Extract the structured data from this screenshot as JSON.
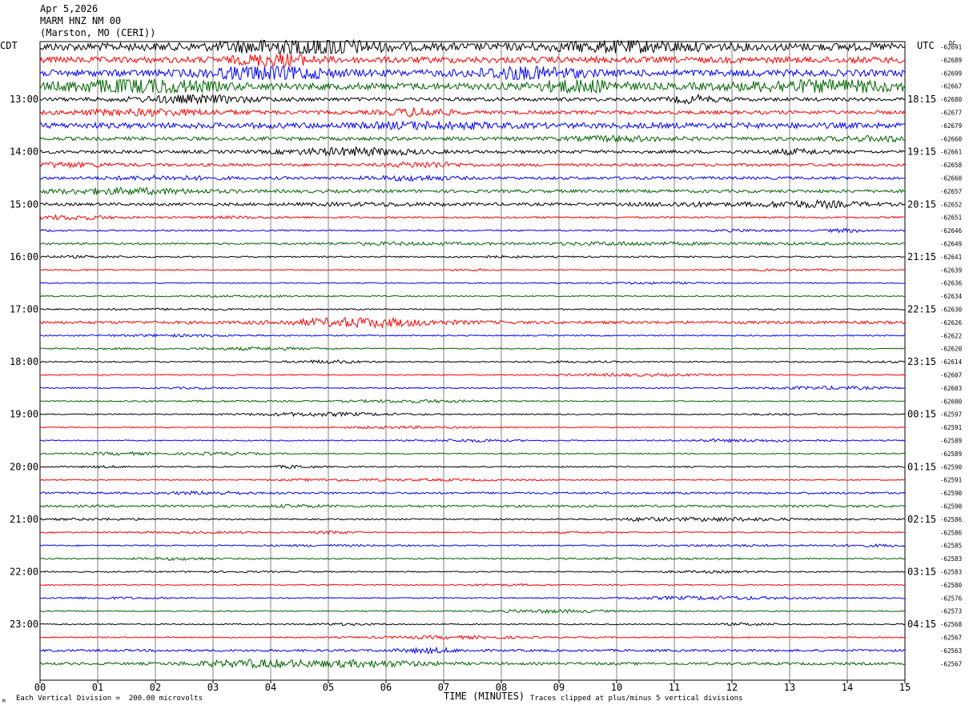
{
  "header": {
    "date": "Apr 5,2026",
    "station": "MARM HNZ NM 00",
    "location": "(Marston, MO (CERI))"
  },
  "chart_data": {
    "type": "line",
    "title": "MARM HNZ NM 00",
    "xlabel": "TIME (MINUTES)",
    "x_ticks": [
      "00",
      "01",
      "02",
      "03",
      "04",
      "05",
      "06",
      "07",
      "08",
      "09",
      "10",
      "11",
      "12",
      "13",
      "14",
      "15"
    ],
    "xlim": [
      0,
      15
    ],
    "left_axis_label": "CDT",
    "right_axis_label": "UTC",
    "dc_label": "DC",
    "left_hour_labels": [
      "13:00",
      "14:00",
      "15:00",
      "16:00",
      "17:00",
      "18:00",
      "19:00",
      "20:00",
      "21:00",
      "22:00",
      "23:00"
    ],
    "right_hour_labels": [
      "18:15",
      "19:15",
      "20:15",
      "21:15",
      "22:15",
      "23:15",
      "00:15",
      "01:15",
      "02:15",
      "03:15",
      "04:15"
    ],
    "trace_colors": [
      "#000000",
      "#ff0000",
      "#0000ff",
      "#006400"
    ],
    "dc_offsets": [
      -62691,
      -62689,
      -62699,
      -62667,
      -62680,
      -62677,
      -62679,
      -62660,
      -62661,
      -62658,
      -62660,
      -62657,
      -62652,
      -62651,
      -62646,
      -62649,
      -62641,
      -62639,
      -62636,
      -62634,
      -62630,
      -62626,
      -62622,
      -62620,
      -62614,
      -62607,
      -62603,
      -62600,
      -62597,
      -62591,
      -62589,
      -62589,
      -62590,
      -62591,
      -62590,
      -62590,
      -62586,
      -62586,
      -62585,
      -62583,
      -62583,
      -62580,
      -62576,
      -62573,
      -62568,
      -62567,
      -62563,
      -62567
    ],
    "trace_activity": [
      3.0,
      2.4,
      2.6,
      2.6,
      1.4,
      1.4,
      2.2,
      1.4,
      1.2,
      1.1,
      1.1,
      1.2,
      1.1,
      0.7,
      0.6,
      0.7,
      0.55,
      0.4,
      0.4,
      0.45,
      0.5,
      1.1,
      0.5,
      0.45,
      0.5,
      0.45,
      0.5,
      0.45,
      0.45,
      0.4,
      0.45,
      0.45,
      0.5,
      0.45,
      0.8,
      0.9,
      0.55,
      0.5,
      0.5,
      0.5,
      0.45,
      0.4,
      0.45,
      0.45,
      0.45,
      0.5,
      0.9,
      1.0
    ],
    "footer_left": "Each Vertical Division =  200.00 microvolts",
    "footer_right": "Traces clipped at plus/minus 5 vertical divisions",
    "corner_mark": "M"
  }
}
